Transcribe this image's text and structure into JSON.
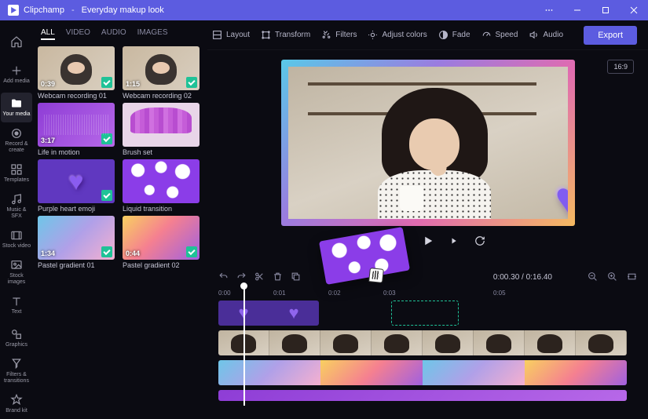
{
  "titlebar": {
    "brand": "Clipchamp",
    "project": "Everyday makup look",
    "separator": "-"
  },
  "nav": {
    "items": [
      {
        "label": "",
        "aria": "Home"
      },
      {
        "label": "Add media"
      },
      {
        "label": "Your media",
        "active": true
      },
      {
        "label": "Record & create"
      },
      {
        "label": "Templates"
      },
      {
        "label": "Music & SFX"
      },
      {
        "label": "Stock video"
      },
      {
        "label": "Stock images"
      },
      {
        "label": "Text"
      },
      {
        "label": "Graphics"
      },
      {
        "label": "Filters & transitions"
      },
      {
        "label": "Brand kit"
      }
    ]
  },
  "tabs": {
    "all": "ALL",
    "video": "VIDEO",
    "audio": "AUDIO",
    "images": "IMAGES"
  },
  "media": [
    {
      "title": "Webcam recording 01",
      "duration": "0:39",
      "checked": true,
      "style": "woman"
    },
    {
      "title": "Webcam recording 02",
      "duration": "1:15",
      "checked": true,
      "style": "woman"
    },
    {
      "title": "Life in motion",
      "duration": "3:17",
      "checked": true,
      "style": "audio"
    },
    {
      "title": "Brush set",
      "duration": "",
      "checked": false,
      "style": "brush"
    },
    {
      "title": "Purple heart emoji",
      "duration": "",
      "checked": true,
      "style": "heart"
    },
    {
      "title": "Liquid transition",
      "duration": "",
      "checked": false,
      "style": "liquid"
    },
    {
      "title": "Pastel gradient 01",
      "duration": "1:34",
      "checked": true,
      "style": "grad1"
    },
    {
      "title": "Pastel gradient 02",
      "duration": "0:44",
      "checked": true,
      "style": "grad2"
    }
  ],
  "toolbar": {
    "layout": "Layout",
    "transform": "Transform",
    "filters": "Filters",
    "adjust": "Adjust colors",
    "fade": "Fade",
    "speed": "Speed",
    "audio": "Audio",
    "export": "Export"
  },
  "aspect": "16:9",
  "playback": {
    "current": "0:00.30",
    "total": "0:16.40",
    "sep": " / "
  },
  "ruler": [
    "0:00",
    "0:01",
    "0:02",
    "0:03",
    "0:05"
  ]
}
